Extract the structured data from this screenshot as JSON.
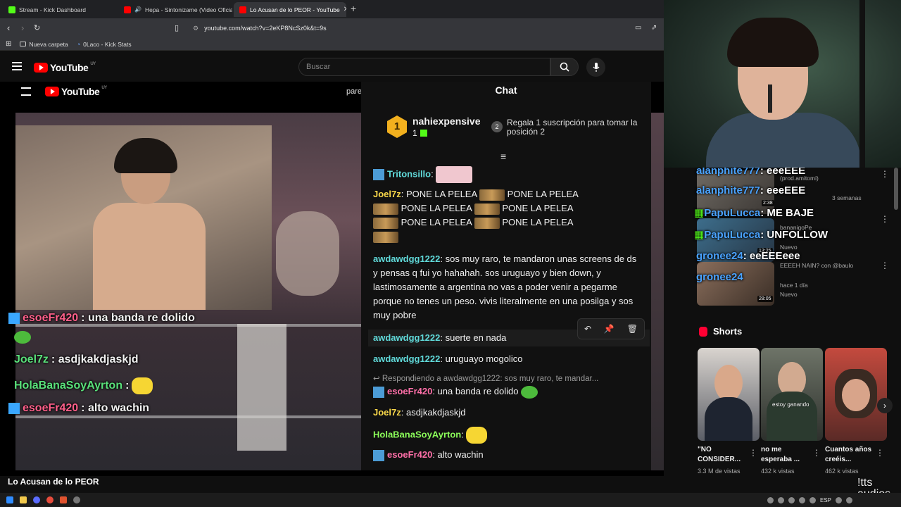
{
  "browser": {
    "tabs": [
      {
        "title": "Stream - Kick Dashboard",
        "favicon_color": "#53fc18",
        "active": false
      },
      {
        "title": "Hepa - Sintonizame (Video Oficial)",
        "favicon_color": "#ff0000",
        "active": false
      },
      {
        "title": "Lo Acusan de lo PEOR - YouTube",
        "favicon_color": "#ff0000",
        "active": true
      }
    ],
    "new_tab": "+",
    "url": "youtube.com/watch?v=2eKP8NcSz0k&t=9s",
    "bookmarks": [
      {
        "label": "Nueva carpeta"
      },
      {
        "label": "0Laco - Kick Stats"
      }
    ]
  },
  "youtube": {
    "logo_text": "YouTube",
    "region": "UY",
    "search_placeholder": "Buscar",
    "inner_chip": "pare",
    "video_title": "Lo Acusan de lo PEOR"
  },
  "video_overlay_chat": [
    {
      "user": "esoeFr420",
      "text": ": una banda re dolido",
      "color": "#ff5f8a"
    },
    {
      "user": "Joel7z",
      "text": ": asdjkakdjaskjd",
      "color": "#59e07a"
    },
    {
      "user": "HolaBanaSoyAyrton",
      "text": ":",
      "color": "#59e07a"
    },
    {
      "user": "esoeFr420",
      "text": ": alto wachin",
      "color": "#ff5f8a"
    }
  ],
  "kick_chat": {
    "title": "Chat",
    "pinned": {
      "rank": "1",
      "user": "nahiexpensive",
      "count": "1",
      "gift_badge": "2",
      "gift_text": "Regala 1 suscripción para tomar la posición 2"
    },
    "messages": [
      {
        "user": "Tritonsillo",
        "text": ":"
      },
      {
        "user": "Joel7z",
        "text": ": PONE LA PELEA",
        "emote_phrase": "PONE LA PELEA"
      },
      {
        "user": "awdawdgg1222",
        "text": ": sos muy raro, te mandaron unas screens de ds y pensas q fui yo hahahah. sos uruguayo y bien down, y lastimosamente a argentina no vas a poder venir a pegarme porque no tenes un peso. vivis literalmente en una posilga y sos muy pobre"
      },
      {
        "user": "awdawdgg1222",
        "text": ": suerte en nada"
      },
      {
        "user": "awdawdgg1222",
        "text": ": uruguayo mogolico"
      },
      {
        "user": "esoeFr420",
        "text": ": una banda re dolido"
      },
      {
        "user": "Joel7z",
        "text": ": asdjkakdjaskjd"
      },
      {
        "user": "HolaBanaSoyAyrton",
        "text": ":"
      },
      {
        "user": "esoeFr420",
        "text": ": alto wachin"
      }
    ],
    "reply_preview": "Respondiendo a awdawdgg1222: sos muy raro, te mandar...",
    "mod_tools": [
      "undo-icon",
      "pin-icon",
      "trash-icon"
    ]
  },
  "recommendations": {
    "overlay_lines": [
      {
        "user": "alanphite777",
        "text": ": eeeEEE",
        "color": "#4aa3ff"
      },
      {
        "user": "alanphite777",
        "text": ": eeeEEE",
        "color": "#4aa3ff"
      },
      {
        "user": "PapuLucca",
        "text": ": ME BAJE",
        "color": "#4aa3ff"
      },
      {
        "user": "PapuLucca",
        "text": ": UNFOLLOW",
        "color": "#4aa3ff"
      },
      {
        "user": "gronee24",
        "text": ": eeEEEeee",
        "color": "#4aa3ff"
      },
      {
        "user": "gronee24",
        "text": "",
        "color": "#4aa3ff"
      }
    ],
    "items": [
      {
        "sub1": "(prod.amitomi)",
        "sub2": "3 semanas",
        "duration": "2:38"
      },
      {
        "sub1": "bananigoPe",
        "sub2": "Nuevo",
        "duration": "13:25"
      },
      {
        "sub1": "EEEEH NAIN? con @baulo",
        "sub2": "hace 1 día",
        "duration": "28:05",
        "badge": "Nuevo"
      }
    ]
  },
  "shorts": {
    "header": "Shorts",
    "items": [
      {
        "title": "\"NO CONSIDER...",
        "views": "3.3 M de vistas",
        "thumb_color": "#5b5e66"
      },
      {
        "title": "no me esperaba ...",
        "views": "432 k vistas",
        "thumb_color": "#3b3d3a",
        "overlay": "estoy ganando"
      },
      {
        "title": "Cuantos años creéis...",
        "views": "462 k vistas",
        "thumb_color": "#7a3a34"
      }
    ]
  },
  "stream_overlay": {
    "audios_label": "!tts\naudios"
  },
  "taskbar": {
    "lang": "ESP"
  }
}
